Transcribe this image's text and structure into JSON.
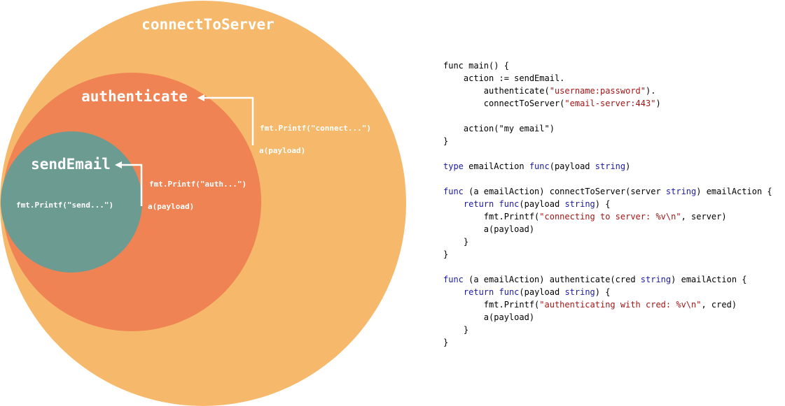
{
  "diagram": {
    "colors": {
      "outer": "#f6b96b",
      "middle": "#ef8354",
      "inner": "#6b9b91",
      "text": "#ffffff"
    },
    "labels": {
      "connect_to_server": "connectToServer",
      "authenticate": "authenticate",
      "send_email": "sendEmail"
    },
    "annotations": {
      "printf_connect": "fmt.Printf(\"connect...\")",
      "payload_connect": "a(payload)",
      "printf_auth": "fmt.Printf(\"auth...\")",
      "payload_auth": "a(payload)",
      "printf_send": "fmt.Printf(\"send...\")"
    }
  },
  "code": {
    "lines": [
      [
        {
          "t": "func main() {",
          "k": "plain"
        }
      ],
      [
        {
          "t": "    action := sendEmail.",
          "k": "plain"
        }
      ],
      [
        {
          "t": "        authenticate(",
          "k": "plain"
        },
        {
          "t": "\"username:password\"",
          "k": "str"
        },
        {
          "t": ").",
          "k": "plain"
        }
      ],
      [
        {
          "t": "        connectToServer(",
          "k": "plain"
        },
        {
          "t": "\"email-server:443\"",
          "k": "str"
        },
        {
          "t": ")",
          "k": "plain"
        }
      ],
      [],
      [
        {
          "t": "    action(\"my email\")",
          "k": "plain"
        }
      ],
      [
        {
          "t": "}",
          "k": "plain"
        }
      ],
      [],
      [
        {
          "t": "type",
          "k": "kw"
        },
        {
          "t": " emailAction ",
          "k": "plain"
        },
        {
          "t": "func",
          "k": "kw"
        },
        {
          "t": "(payload ",
          "k": "plain"
        },
        {
          "t": "string",
          "k": "kw"
        },
        {
          "t": ")",
          "k": "plain"
        }
      ],
      [],
      [
        {
          "t": "func",
          "k": "kw"
        },
        {
          "t": " (a emailAction) connectToServer(server ",
          "k": "plain"
        },
        {
          "t": "string",
          "k": "kw"
        },
        {
          "t": ") emailAction {",
          "k": "plain"
        }
      ],
      [
        {
          "t": "    ",
          "k": "plain"
        },
        {
          "t": "return",
          "k": "kw"
        },
        {
          "t": " ",
          "k": "plain"
        },
        {
          "t": "func",
          "k": "kw"
        },
        {
          "t": "(payload ",
          "k": "plain"
        },
        {
          "t": "string",
          "k": "kw"
        },
        {
          "t": ") {",
          "k": "plain"
        }
      ],
      [
        {
          "t": "        fmt.Printf(",
          "k": "plain"
        },
        {
          "t": "\"connecting to server: %v\\n\"",
          "k": "str"
        },
        {
          "t": ", server)",
          "k": "plain"
        }
      ],
      [
        {
          "t": "        a(payload)",
          "k": "plain"
        }
      ],
      [
        {
          "t": "    }",
          "k": "plain"
        }
      ],
      [
        {
          "t": "}",
          "k": "plain"
        }
      ],
      [],
      [
        {
          "t": "func",
          "k": "kw"
        },
        {
          "t": " (a emailAction) authenticate(cred ",
          "k": "plain"
        },
        {
          "t": "string",
          "k": "kw"
        },
        {
          "t": ") emailAction {",
          "k": "plain"
        }
      ],
      [
        {
          "t": "    ",
          "k": "plain"
        },
        {
          "t": "return",
          "k": "kw"
        },
        {
          "t": " ",
          "k": "plain"
        },
        {
          "t": "func",
          "k": "kw"
        },
        {
          "t": "(payload ",
          "k": "plain"
        },
        {
          "t": "string",
          "k": "kw"
        },
        {
          "t": ") {",
          "k": "plain"
        }
      ],
      [
        {
          "t": "        fmt.Printf(",
          "k": "plain"
        },
        {
          "t": "\"authenticating with cred: %v\\n\"",
          "k": "str"
        },
        {
          "t": ", cred)",
          "k": "plain"
        }
      ],
      [
        {
          "t": "        a(payload)",
          "k": "plain"
        }
      ],
      [
        {
          "t": "    }",
          "k": "plain"
        }
      ],
      [
        {
          "t": "}",
          "k": "plain"
        }
      ]
    ]
  }
}
